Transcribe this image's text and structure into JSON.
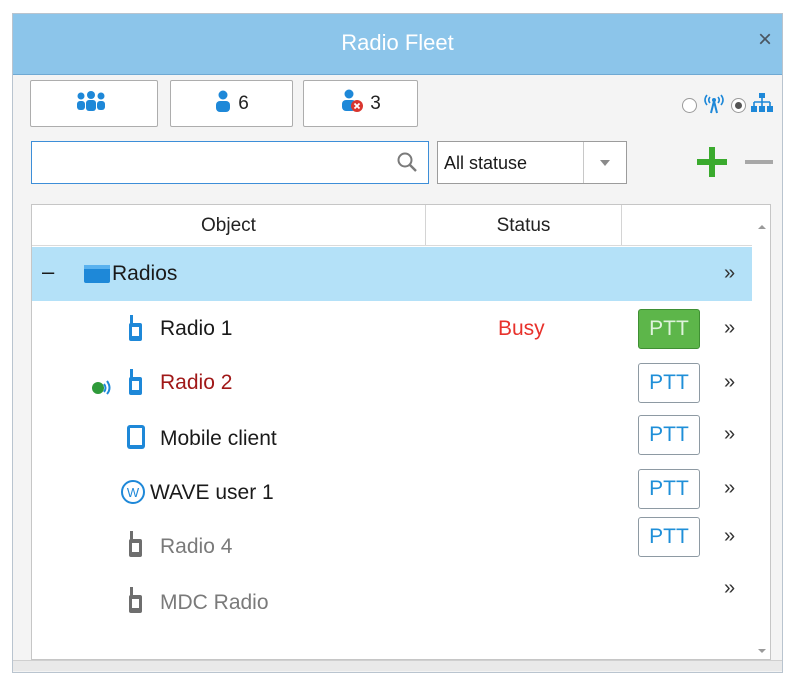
{
  "window": {
    "title": "Radio Fleet",
    "close_glyph": "×"
  },
  "toolbar": {
    "buttons": [
      {
        "icon": "talkgroup-icon",
        "label": ""
      },
      {
        "icon": "user-icon",
        "label": "6"
      },
      {
        "icon": "user-offline-icon",
        "label": "3"
      }
    ],
    "view_mode": {
      "options": [
        "radio-tower-icon",
        "hierarchy-icon"
      ],
      "selected": "hierarchy-icon"
    }
  },
  "search": {
    "value": "",
    "placeholder": ""
  },
  "status_filter": {
    "selected": "All statuse"
  },
  "actions": {
    "add_icon": "plus-icon",
    "remove_icon": "minus-icon"
  },
  "table": {
    "columns": [
      "Object",
      "Status",
      ""
    ],
    "group": {
      "collapse_glyph": "–",
      "label": "Radios",
      "more": "»"
    },
    "rows": [
      {
        "name": "Radio 1",
        "status": "Busy",
        "ptt": "PTT",
        "ptt_state": "active",
        "more": "»",
        "icon": "radio-icon",
        "color": "#1a1a1a"
      },
      {
        "name": "Radio 2",
        "status": "",
        "ptt": "PTT",
        "ptt_state": "normal",
        "more": "»",
        "icon": "radio-icon",
        "color": "#a01818",
        "extra_icon": "signal-icon"
      },
      {
        "name": "Mobile client",
        "status": "",
        "ptt": "PTT",
        "ptt_state": "normal",
        "more": "»",
        "icon": "mobile-icon",
        "color": "#1a1a1a"
      },
      {
        "name": "WAVE user 1",
        "status": "",
        "ptt": "PTT",
        "ptt_state": "normal",
        "more": "»",
        "icon": "wave-icon",
        "color": "#1a1a1a"
      },
      {
        "name": "Radio 4",
        "status": "",
        "ptt": "PTT",
        "ptt_state": "normal",
        "more": "»",
        "icon": "radio-offline-icon",
        "color": "#7a7a7a"
      },
      {
        "name": "MDC Radio",
        "status": "",
        "ptt": "",
        "ptt_state": "none",
        "more": "»",
        "icon": "radio-offline-icon",
        "color": "#7a7a7a"
      }
    ]
  },
  "colors": {
    "accent": "#8cc5ea",
    "selected_row": "#b4e1f8",
    "busy": "#e8322c",
    "ptt_active": "#5db64a",
    "ptt_text": "#1f8fd8",
    "add": "#3aaa2e"
  }
}
